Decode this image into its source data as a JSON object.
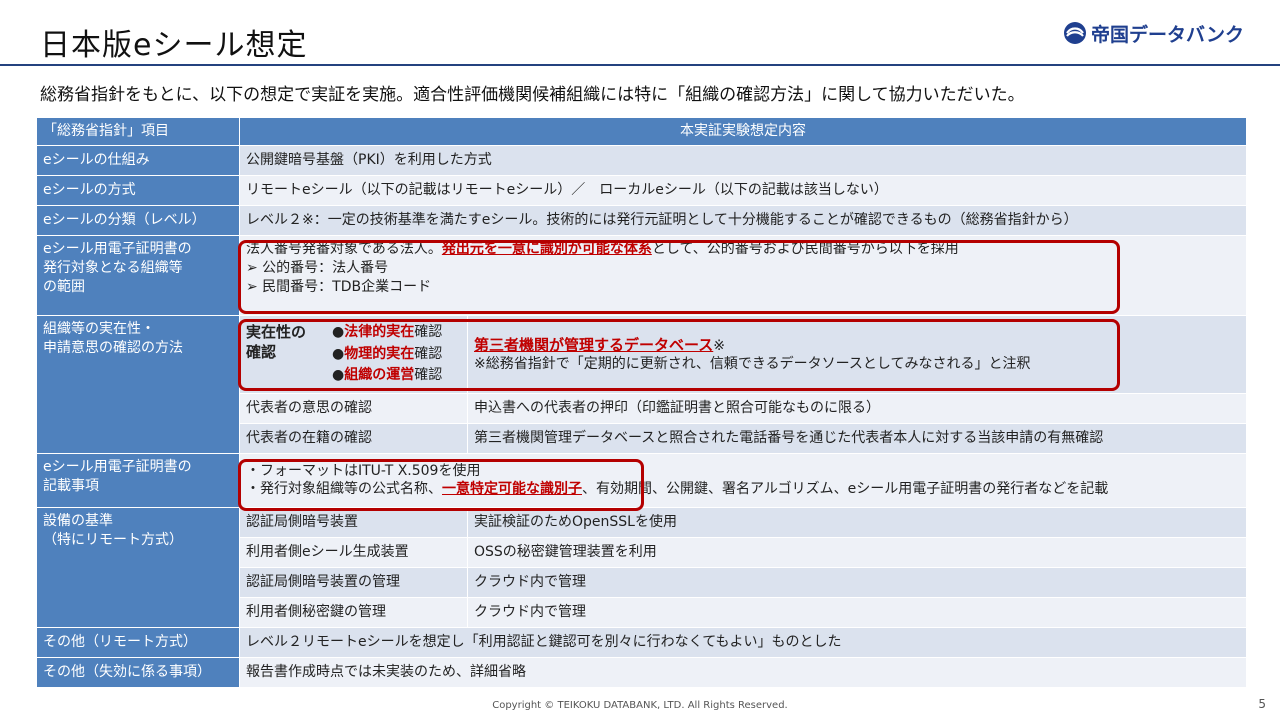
{
  "header": {
    "title": "日本版eシール想定",
    "logo_text": "帝国データバンク",
    "subtitle": "総務省指針をもとに、以下の想定で実証を実施。適合性評価機関候補組織には特に「組織の確認方法」に関して協力いただいた。"
  },
  "table": {
    "col1_header": "「総務省指針」項目",
    "col2_header": "本実証実験想定内容",
    "r1": {
      "label": "eシールの仕組み",
      "value": "公開鍵暗号基盤（PKI）を利用した方式"
    },
    "r2": {
      "label": "eシールの方式",
      "value": "リモートeシール（以下の記載はリモートeシール）／　ローカルeシール（以下の記載は該当しない）"
    },
    "r3": {
      "label": "eシールの分類（レベル）",
      "value": "レベル２※：一定の技術基準を満たすeシール。技術的には発行元証明として十分機能することが確認できるもの（総務省指針から）"
    },
    "r4": {
      "label1": "eシール用電子証明書の",
      "label2": "発行対象となる組織等",
      "label3": "の範囲",
      "line1_pre": "法人番号発番対象である法人。",
      "line1_em": "発出元を一意に識別が可能な体系",
      "line1_post": "として、公的番号および民間番号から以下を採用",
      "line2": "➢ 公的番号：法人番号",
      "line3": "➢ 民間番号：TDB企業コード"
    },
    "r5": {
      "label1": "組織等の実在性・",
      "label2": "申請意思の確認の方法",
      "sub_label1": "実在性の",
      "sub_label2": "確認",
      "bullet": "●",
      "item1_em": "法律的実在",
      "item2_em": "物理的実在",
      "item3_em": "組織の運営",
      "item_suffix": "確認",
      "db_em": "第三者機関が管理するデータベース",
      "db_mark": "※",
      "db_note": "※総務省指針で「定期的に更新され、信頼できるデータソースとしてみなされる」と注釈"
    },
    "r6": {
      "sub_label": "代表者の意思の確認",
      "value": "申込書への代表者の押印（印鑑証明書と照合可能なものに限る）"
    },
    "r7": {
      "sub_label": "代表者の在籍の確認",
      "value": "第三者機関管理データベースと照合された電話番号を通じた代表者本人に対する当該申請の有無確認"
    },
    "r8": {
      "label1": "eシール用電子証明書の",
      "label2": "記載事項",
      "line1": "・フォーマットはITU-T X.509を使用",
      "line2_pre": "・発行対象組織等の公式名称、",
      "line2_em": "一意特定可能な識別子",
      "line2_post": "、有効期間、公開鍵、署名アルゴリズム、eシール用電子証明書の発行者などを記載"
    },
    "r9": {
      "label1": "設備の基準",
      "label2": "（特にリモート方式）",
      "rows": [
        {
          "sub": "認証局側暗号装置",
          "value": "実証検証のためOpenSSLを使用"
        },
        {
          "sub": "利用者側eシール生成装置",
          "value": "OSSの秘密鍵管理装置を利用"
        },
        {
          "sub": "認証局側暗号装置の管理",
          "value": "クラウド内で管理"
        },
        {
          "sub": "利用者側秘密鍵の管理",
          "value": "クラウド内で管理"
        }
      ]
    },
    "r10": {
      "label": "その他（リモート方式）",
      "value": "レベル２リモートeシールを想定し「利用認証と鍵認可を別々に行わなくてもよい」ものとした"
    },
    "r11": {
      "label": "その他（失効に係る事項）",
      "value": "報告書作成時点では未実装のため、詳細省略"
    }
  },
  "footer": {
    "copyright": "Copyright © TEIKOKU DATABANK, LTD. All Rights Reserved.",
    "page": "5"
  },
  "colors": {
    "header_blue": "#4f81bd",
    "row_light": "#dbe2ee",
    "row_lighter": "#eef1f7",
    "emphasis_red": "#c00000",
    "rule_navy": "#24427f"
  }
}
